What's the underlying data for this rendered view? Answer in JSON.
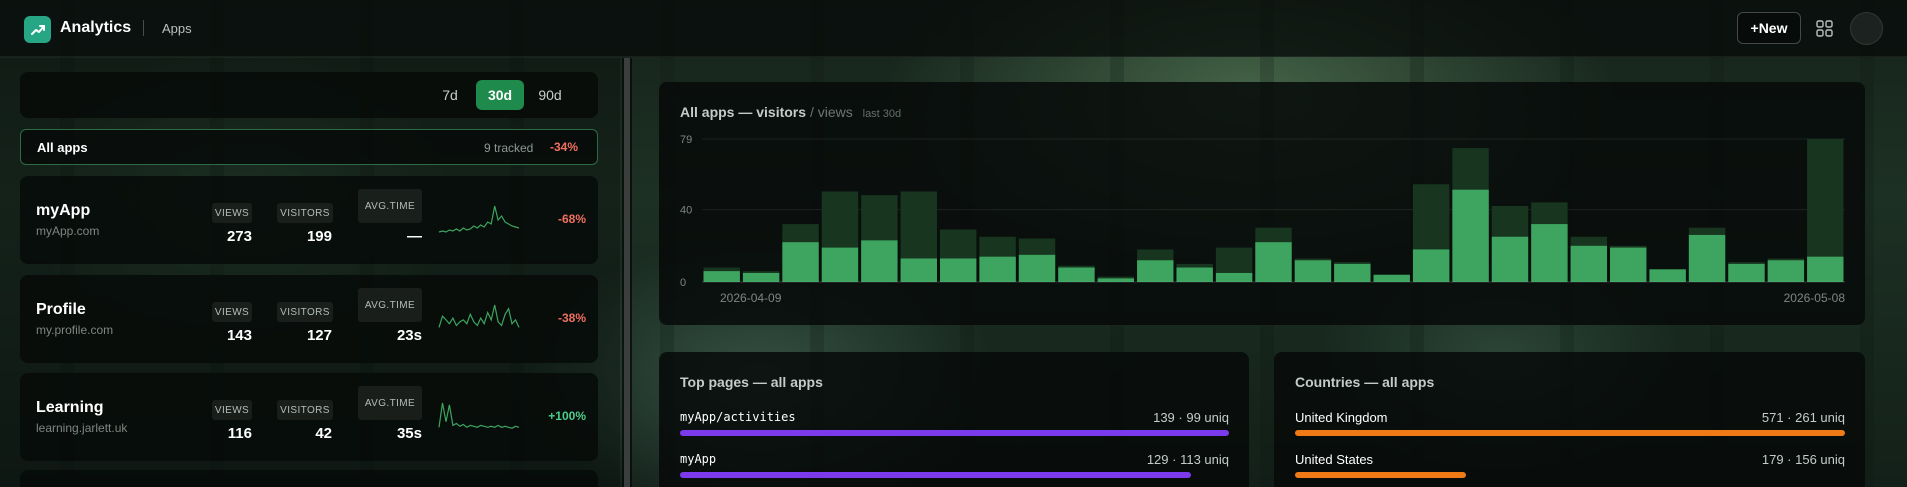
{
  "header": {
    "brand": "Analytics",
    "crumb": "Apps",
    "new_label": "+New",
    "icons": {
      "logo": "trend-up-icon",
      "apps": "grid-icon",
      "avatar": "avatar"
    }
  },
  "range": {
    "options": [
      "7d",
      "30d",
      "90d"
    ],
    "selected": "30d"
  },
  "all_apps": {
    "label": "All apps",
    "tracked": "9 tracked",
    "change": "-34%"
  },
  "metric_labels": {
    "views": "VIEWS",
    "visitors": "VISITORS",
    "avg_time_line1": "AVG.",
    "avg_time_line2": "TIME"
  },
  "apps": [
    {
      "name": "myApp",
      "domain": "myApp.com",
      "views": "273",
      "visitors": "199",
      "avg_time": "—",
      "change": "-68%",
      "trend": "neg",
      "spark": [
        2,
        3,
        2,
        4,
        3,
        5,
        3,
        6,
        4,
        5,
        8,
        6,
        9,
        7,
        12,
        10,
        28,
        14,
        18,
        12,
        10,
        8,
        7,
        6
      ]
    },
    {
      "name": "Profile",
      "domain": "my.profile.com",
      "views": "143",
      "visitors": "127",
      "avg_time": "23s",
      "change": "-38%",
      "trend": "neg",
      "spark": [
        6,
        18,
        14,
        10,
        16,
        8,
        12,
        14,
        10,
        20,
        12,
        8,
        16,
        10,
        22,
        14,
        30,
        12,
        8,
        20,
        26,
        10,
        14,
        6
      ]
    },
    {
      "name": "Learning",
      "domain": "learning.jarlett.uk",
      "views": "116",
      "visitors": "42",
      "avg_time": "35s",
      "change": "+100%",
      "trend": "pos",
      "spark": [
        4,
        30,
        10,
        28,
        6,
        8,
        5,
        7,
        4,
        6,
        5,
        4,
        6,
        5,
        4,
        5,
        4,
        6,
        4,
        5,
        4,
        3,
        5,
        4
      ]
    }
  ],
  "main_chart": {
    "title": "All apps — visitors",
    "title_secondary": "/ views",
    "period": "last 30d"
  },
  "chart_data": {
    "type": "bar",
    "x_start": "2026-04-09",
    "x_end": "2026-05-08",
    "y_ticks": [
      0,
      40,
      79
    ],
    "ylim": [
      0,
      79
    ],
    "series": [
      {
        "name": "visitors",
        "values": [
          6,
          5,
          22,
          19,
          23,
          13,
          13,
          14,
          15,
          8,
          2,
          12,
          8,
          5,
          22,
          12,
          10,
          4,
          18,
          51,
          25,
          32,
          20,
          19,
          7,
          26,
          10,
          12,
          14
        ]
      },
      {
        "name": "views",
        "values": [
          8,
          6,
          32,
          50,
          48,
          50,
          29,
          25,
          24,
          9,
          3,
          18,
          10,
          19,
          30,
          13,
          11,
          4,
          54,
          74,
          42,
          44,
          25,
          20,
          7,
          30,
          11,
          13,
          79
        ]
      }
    ]
  },
  "top_pages": {
    "title": "Top pages — all apps",
    "items": [
      {
        "label": "myApp/activities",
        "value": "139 · 99 uniq",
        "fraction": 1.0
      },
      {
        "label": "myApp",
        "value": "129 · 113 uniq",
        "fraction": 0.93
      }
    ],
    "bar_color": "#7c3aed"
  },
  "countries": {
    "title": "Countries — all apps",
    "items": [
      {
        "label": "United Kingdom",
        "value": "571 · 261 uniq",
        "fraction": 1.0
      },
      {
        "label": "United States",
        "value": "179 · 156 uniq",
        "fraction": 0.31
      }
    ],
    "bar_color": "#f07a16"
  },
  "colors": {
    "accent_green": "#3da560",
    "views_green": "#17351f",
    "negative": "#f07060",
    "positive": "#4ccd8a"
  }
}
